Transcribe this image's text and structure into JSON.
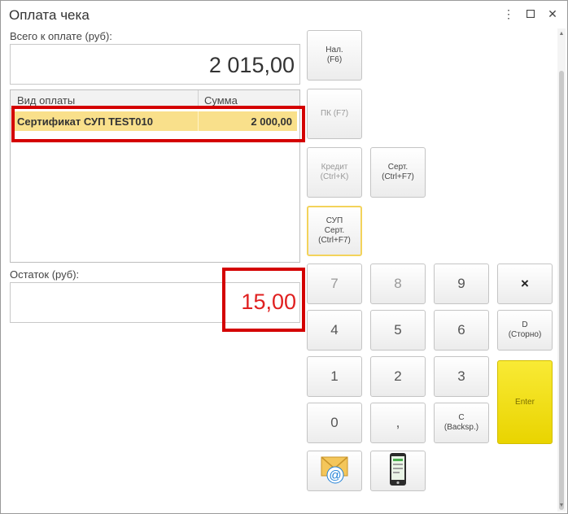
{
  "window": {
    "title": "Оплата чека"
  },
  "total": {
    "label": "Всего к оплате (руб):",
    "value": "2 015,00"
  },
  "payments": {
    "headers": [
      "Вид оплаты",
      "Сумма"
    ],
    "rows": [
      {
        "type": "Сертификат СУП TEST010",
        "amount": "2 000,00"
      }
    ]
  },
  "remainder": {
    "label": "Остаток (руб):",
    "value": "15,00"
  },
  "buttons": {
    "cash": "Нал.\n(F6)",
    "card": "ПК (F7)",
    "credit": "Кредит\n(Ctrl+K)",
    "cert": "Серт.\n(Ctrl+F7)",
    "sup_cert": "СУП\nСерт.\n(Ctrl+F7)",
    "d_storno": "D\n(Сторно)",
    "enter": "Enter",
    "backspace": "C\n(Backsp.)",
    "clear": "×"
  },
  "keypad": {
    "k7": "7",
    "k8": "8",
    "k9": "9",
    "k4": "4",
    "k5": "5",
    "k6": "6",
    "k1": "1",
    "k2": "2",
    "k3": "3",
    "k0": "0",
    "comma": ","
  },
  "icons": {
    "email": "email-icon",
    "phone": "phone-icon",
    "menu": "more-vertical-icon",
    "maximize": "maximize-icon",
    "close": "close-icon"
  },
  "colors": {
    "highlight_row": "#f9e08b",
    "remainder": "#e02020",
    "enter_button": "#f0dd1a",
    "annotation": "#d40000"
  }
}
